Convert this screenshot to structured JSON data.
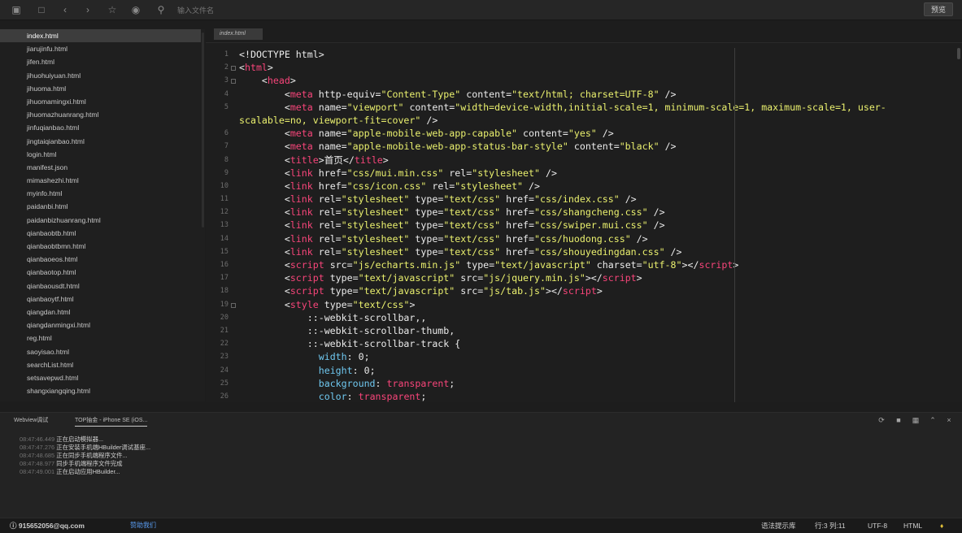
{
  "toolbar": {
    "icons": [
      "new-file-icon",
      "save-icon",
      "back-icon",
      "forward-icon",
      "star-icon",
      "run-icon",
      "find-icon"
    ],
    "search_placeholder": "输入文件名",
    "preview_label": "预览"
  },
  "sidebar": {
    "files": [
      "index.html",
      "jiarujinfu.html",
      "jifen.html",
      "jihuohuiyuan.html",
      "jihuoma.html",
      "jihuomamingxi.html",
      "jihuomazhuanrang.html",
      "jinfuqianbao.html",
      "jingtaiqianbao.html",
      "login.html",
      "manifest.json",
      "mimashezhi.html",
      "myinfo.html",
      "paidanbi.html",
      "paidanbizhuanrang.html",
      "qianbaobtb.html",
      "qianbaobtbmn.html",
      "qianbaoeos.html",
      "qianbaotop.html",
      "qianbaousdt.html",
      "qianbaoytf.html",
      "qiangdan.html",
      "qiangdanmingxi.html",
      "reg.html",
      "saoyisao.html",
      "searchList.html",
      "setsavepwd.html",
      "shangxiangqing.html"
    ],
    "active_index": 0
  },
  "editor": {
    "tab_label": "index.html",
    "lines": [
      {
        "n": "1",
        "tall": false,
        "fold": false,
        "html": "<span class=\"w\">&lt;!DOCTYPE html&gt;</span>"
      },
      {
        "n": "2",
        "tall": false,
        "fold": true,
        "html": "<span class=\"w\">&lt;</span><span class=\"t\">html</span><span class=\"w\">&gt;</span>"
      },
      {
        "n": "3",
        "tall": false,
        "fold": true,
        "html": "    <span class=\"w\">&lt;</span><span class=\"t\">head</span><span class=\"w\">&gt;</span>"
      },
      {
        "n": "4",
        "tall": false,
        "fold": false,
        "html": "        <span class=\"w\">&lt;</span><span class=\"t\">meta</span> <span class=\"w\">http-equiv=</span><span class=\"s\">\"Content-Type\"</span> <span class=\"w\">content=</span><span class=\"s\">\"text/html; charset=UTF-8\"</span> <span class=\"w\">/&gt;</span>"
      },
      {
        "n": "5",
        "tall": true,
        "fold": false,
        "html": "        <span class=\"w\">&lt;</span><span class=\"t\">meta</span> <span class=\"w\">name=</span><span class=\"s\">\"viewport\"</span> <span class=\"w\">content=</span><span class=\"s\">\"width=device-width,initial-scale=1, minimum-scale=1, maximum-scale=1, user-scalable=no, viewport-fit=cover\"</span> <span class=\"w\">/&gt;</span>"
      },
      {
        "n": "6",
        "tall": false,
        "fold": false,
        "html": "        <span class=\"w\">&lt;</span><span class=\"t\">meta</span> <span class=\"w\">name=</span><span class=\"s\">\"apple-mobile-web-app-capable\"</span> <span class=\"w\">content=</span><span class=\"s\">\"yes\"</span> <span class=\"w\">/&gt;</span>"
      },
      {
        "n": "7",
        "tall": false,
        "fold": false,
        "html": "        <span class=\"w\">&lt;</span><span class=\"t\">meta</span> <span class=\"w\">name=</span><span class=\"s\">\"apple-mobile-web-app-status-bar-style\"</span> <span class=\"w\">content=</span><span class=\"s\">\"black\"</span> <span class=\"w\">/&gt;</span>"
      },
      {
        "n": "8",
        "tall": false,
        "fold": false,
        "html": "        <span class=\"w\">&lt;</span><span class=\"t\">title</span><span class=\"w\">&gt;首页&lt;/</span><span class=\"t\">title</span><span class=\"w\">&gt;</span>"
      },
      {
        "n": "9",
        "tall": false,
        "fold": false,
        "html": "        <span class=\"w\">&lt;</span><span class=\"t\">link</span> <span class=\"w\">href=</span><span class=\"s\">\"css/mui.min.css\"</span> <span class=\"w\">rel=</span><span class=\"s\">\"stylesheet\"</span> <span class=\"w\">/&gt;</span>"
      },
      {
        "n": "10",
        "tall": false,
        "fold": false,
        "html": "        <span class=\"w\">&lt;</span><span class=\"t\">link</span> <span class=\"w\">href=</span><span class=\"s\">\"css/icon.css\"</span> <span class=\"w\">rel=</span><span class=\"s\">\"stylesheet\"</span> <span class=\"w\">/&gt;</span>"
      },
      {
        "n": "11",
        "tall": false,
        "fold": false,
        "html": "        <span class=\"w\">&lt;</span><span class=\"t\">link</span> <span class=\"w\">rel=</span><span class=\"s\">\"stylesheet\"</span> <span class=\"w\">type=</span><span class=\"s\">\"text/css\"</span> <span class=\"w\">href=</span><span class=\"s\">\"css/index.css\"</span> <span class=\"w\">/&gt;</span>"
      },
      {
        "n": "12",
        "tall": false,
        "fold": false,
        "html": "        <span class=\"w\">&lt;</span><span class=\"t\">link</span> <span class=\"w\">rel=</span><span class=\"s\">\"stylesheet\"</span> <span class=\"w\">type=</span><span class=\"s\">\"text/css\"</span> <span class=\"w\">href=</span><span class=\"s\">\"css/shangcheng.css\"</span> <span class=\"w\">/&gt;</span>"
      },
      {
        "n": "13",
        "tall": false,
        "fold": false,
        "html": "        <span class=\"w\">&lt;</span><span class=\"t\">link</span> <span class=\"w\">rel=</span><span class=\"s\">\"stylesheet\"</span> <span class=\"w\">type=</span><span class=\"s\">\"text/css\"</span> <span class=\"w\">href=</span><span class=\"s\">\"css/swiper.mui.css\"</span> <span class=\"w\">/&gt;</span>"
      },
      {
        "n": "14",
        "tall": false,
        "fold": false,
        "html": "        <span class=\"w\">&lt;</span><span class=\"t\">link</span> <span class=\"w\">rel=</span><span class=\"s\">\"stylesheet\"</span> <span class=\"w\">type=</span><span class=\"s\">\"text/css\"</span> <span class=\"w\">href=</span><span class=\"s\">\"css/huodong.css\"</span> <span class=\"w\">/&gt;</span>"
      },
      {
        "n": "15",
        "tall": false,
        "fold": false,
        "html": "        <span class=\"w\">&lt;</span><span class=\"t\">link</span> <span class=\"w\">rel=</span><span class=\"s\">\"stylesheet\"</span> <span class=\"w\">type=</span><span class=\"s\">\"text/css\"</span> <span class=\"w\">href=</span><span class=\"s\">\"css/shouyedingdan.css\"</span> <span class=\"w\">/&gt;</span>"
      },
      {
        "n": "16",
        "tall": false,
        "fold": false,
        "html": "        <span class=\"w\">&lt;</span><span class=\"t\">script</span> <span class=\"w\">src=</span><span class=\"s\">\"js/echarts.min.js\"</span> <span class=\"w\">type=</span><span class=\"s\">\"text/javascript\"</span> <span class=\"w\">charset=</span><span class=\"s\">\"utf-8\"</span><span class=\"w\">&gt;&lt;/</span><span class=\"t\">script</span><span class=\"w\">&gt;</span>"
      },
      {
        "n": "17",
        "tall": false,
        "fold": false,
        "html": "        <span class=\"w\">&lt;</span><span class=\"t\">script</span> <span class=\"w\">type=</span><span class=\"s\">\"text/javascript\"</span> <span class=\"w\">src=</span><span class=\"s\">\"js/jquery.min.js\"</span><span class=\"w\">&gt;&lt;/</span><span class=\"t\">script</span><span class=\"w\">&gt;</span>"
      },
      {
        "n": "18",
        "tall": false,
        "fold": false,
        "html": "        <span class=\"w\">&lt;</span><span class=\"t\">script</span> <span class=\"w\">type=</span><span class=\"s\">\"text/javascript\"</span> <span class=\"w\">src=</span><span class=\"s\">\"js/tab.js\"</span><span class=\"w\">&gt;&lt;/</span><span class=\"t\">script</span><span class=\"w\">&gt;</span>"
      },
      {
        "n": "19",
        "tall": false,
        "fold": true,
        "html": "        <span class=\"w\">&lt;</span><span class=\"t\">style</span> <span class=\"w\">type=</span><span class=\"s\">\"text/css\"</span><span class=\"w\">&gt;</span>"
      },
      {
        "n": "20",
        "tall": false,
        "fold": false,
        "html": "            <span class=\"w\">::-webkit-scrollbar,,</span>"
      },
      {
        "n": "21",
        "tall": false,
        "fold": false,
        "html": "            <span class=\"w\">::-webkit-scrollbar-thumb,</span>"
      },
      {
        "n": "22",
        "tall": false,
        "fold": false,
        "html": "            <span class=\"w\">::-webkit-scrollbar-track {</span>"
      },
      {
        "n": "23",
        "tall": false,
        "fold": false,
        "html": "              <span class=\"k\">width</span><span class=\"w\">: 0;</span>"
      },
      {
        "n": "24",
        "tall": false,
        "fold": false,
        "html": "              <span class=\"k\">height</span><span class=\"w\">: 0;</span>"
      },
      {
        "n": "25",
        "tall": false,
        "fold": false,
        "html": "              <span class=\"k\">background</span><span class=\"w\">: </span><span class=\"t\">transparent</span><span class=\"w\">;</span>"
      },
      {
        "n": "26",
        "tall": false,
        "fold": false,
        "html": "              <span class=\"k\">color</span><span class=\"w\">: </span><span class=\"t\">transparent</span><span class=\"w\">;</span>"
      }
    ]
  },
  "console": {
    "tabs": [
      "Webview调试",
      "TOP抽金 - iPhone SE (iOS..."
    ],
    "active_tab": 1,
    "controls": [
      "restart-icon",
      "stop-icon",
      "window-icon",
      "collapse-icon",
      "close-icon"
    ],
    "log": [
      {
        "time": "08:47:46.449",
        "msg": "正在启动模拟器..."
      },
      {
        "time": "08:47:47.276",
        "msg": "正在安装手机端HBuilder调试基座..."
      },
      {
        "time": "08:47:48.685",
        "msg": "正在同步手机端程序文件..."
      },
      {
        "time": "08:47:48.977",
        "msg": "同步手机端程序文件完成"
      },
      {
        "time": "08:47:49.001",
        "msg": "正在启动应用HBuilder..."
      }
    ]
  },
  "statusbar": {
    "user": "915652056@qq.com",
    "help": "赞助我们",
    "syntax_lib": "语法提示库",
    "position": "行:3  列:11",
    "encoding": "UTF-8",
    "language": "HTML"
  },
  "colors": {
    "tag": "#f8457a",
    "string": "#eaf06e",
    "property": "#6fc8f0",
    "background": "#1e1e1e",
    "bell": "#e5c33a"
  }
}
